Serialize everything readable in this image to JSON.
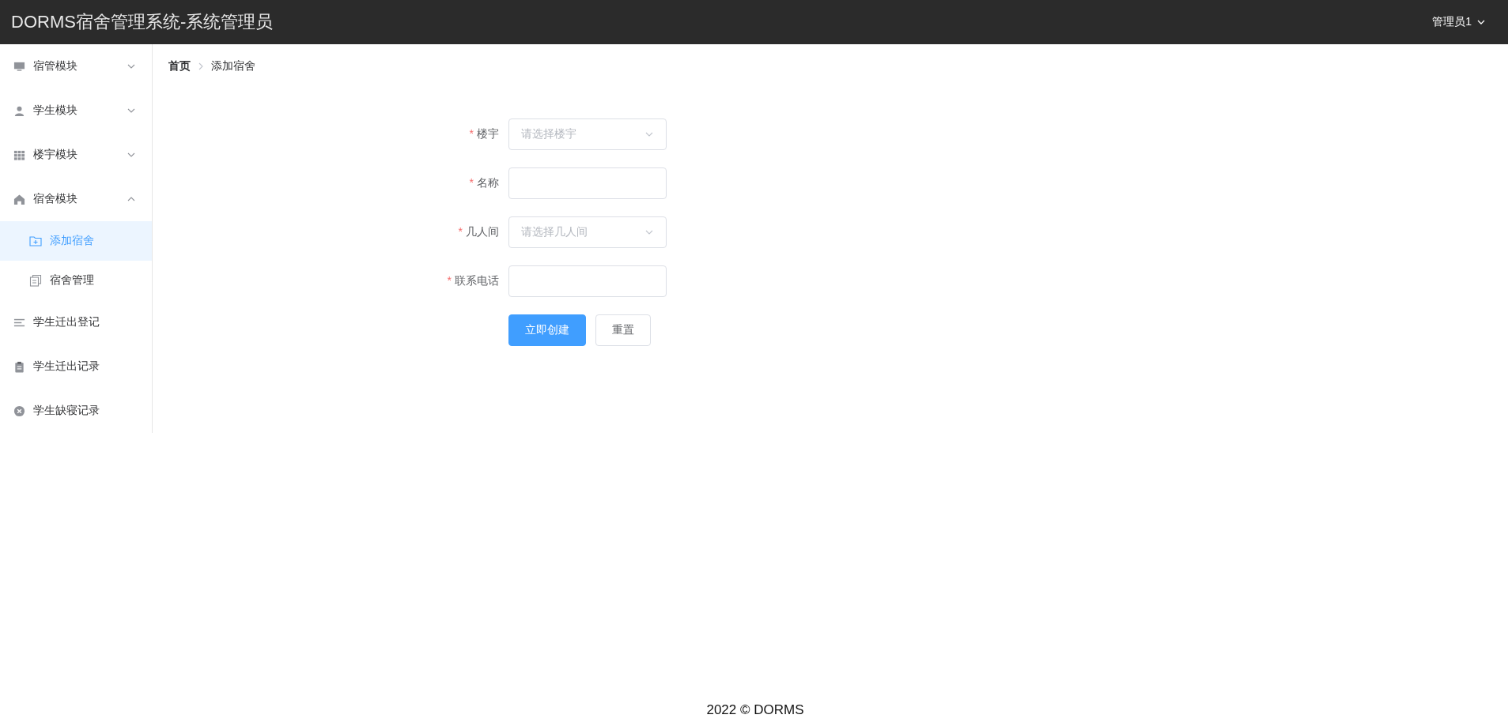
{
  "header": {
    "title": "DORMS宿舍管理系统-系统管理员",
    "user": "管理员1"
  },
  "sidebar": {
    "items": [
      {
        "label": "宿管模块",
        "expanded": false,
        "selected": false
      },
      {
        "label": "学生模块",
        "expanded": false,
        "selected": false
      },
      {
        "label": "楼宇模块",
        "expanded": false,
        "selected": false
      },
      {
        "label": "宿舍模块",
        "expanded": true,
        "selected": false,
        "children": [
          {
            "label": "添加宿舍",
            "selected": true
          },
          {
            "label": "宿舍管理",
            "selected": false
          }
        ]
      },
      {
        "label": "学生迁出登记",
        "selected": false
      },
      {
        "label": "学生迁出记录",
        "selected": false
      },
      {
        "label": "学生缺寝记录",
        "selected": false
      }
    ]
  },
  "breadcrumb": [
    "首页",
    "添加宿舍"
  ],
  "form": {
    "fields": [
      {
        "kind": "select",
        "required_mark": "*",
        "label": "楼宇",
        "placeholder": "请选择楼宇"
      },
      {
        "kind": "input",
        "required_mark": "*",
        "label": "名称"
      },
      {
        "kind": "select",
        "required_mark": "*",
        "label": "几人间",
        "placeholder": "请选择几人间"
      },
      {
        "kind": "input",
        "required_mark": "*",
        "label": "联系电话"
      }
    ],
    "buttons": [
      {
        "label": "立即创建",
        "kind": "primary"
      },
      {
        "label": "重置",
        "kind": "default"
      }
    ]
  },
  "footer": "2022 © DORMS"
}
